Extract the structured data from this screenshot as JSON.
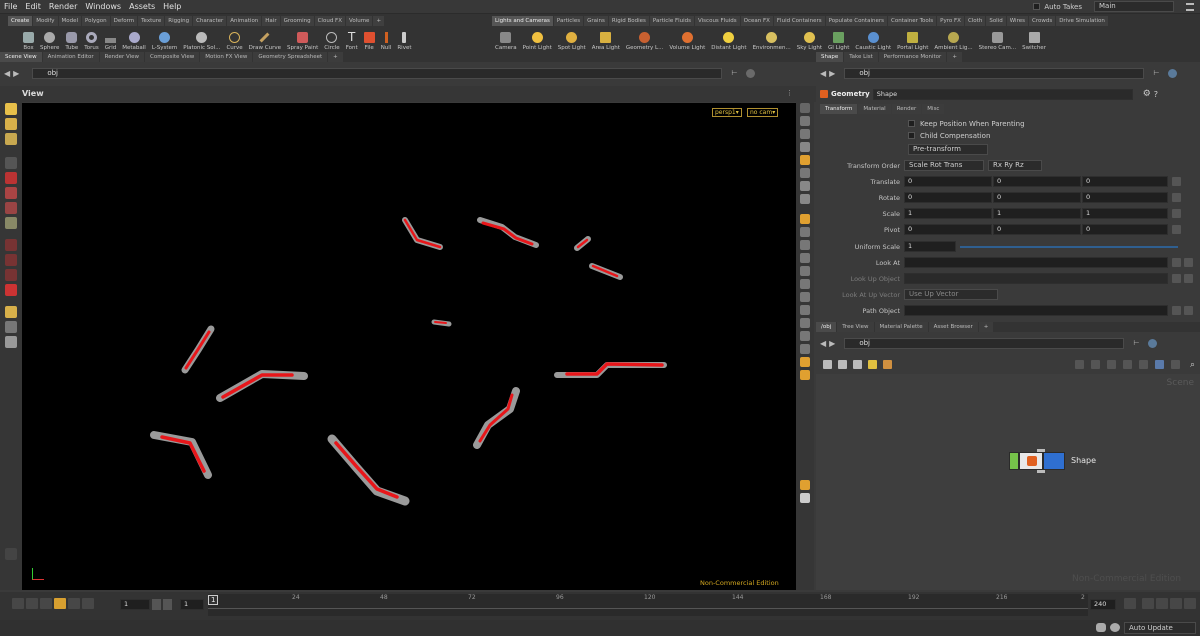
{
  "menu": {
    "items": [
      "File",
      "Edit",
      "Render",
      "Windows",
      "Assets",
      "Help"
    ],
    "auto_takes": "Auto Takes",
    "desktop": "Main"
  },
  "shelf_left_tabs": [
    "Create",
    "Modify",
    "Model",
    "Polygon",
    "Deform",
    "Texture",
    "Rigging",
    "Character",
    "Animation",
    "Hair",
    "Grooming",
    "Cloud FX",
    "Volume"
  ],
  "shelf_right_tabs": [
    "Lights and Cameras",
    "Particles",
    "Grains",
    "Rigid Bodies",
    "Particle Fluids",
    "Viscous Fluids",
    "Ocean FX",
    "Fluid Containers",
    "Populate Containers",
    "Container Tools",
    "Pyro FX",
    "Cloth",
    "Solid",
    "Wires",
    "Crowds",
    "Drive Simulation"
  ],
  "shelf_left_tools": [
    "Box",
    "Sphere",
    "Tube",
    "Torus",
    "Grid",
    "Metaball",
    "L-System",
    "Platonic Sol...",
    "Curve",
    "Draw Curve",
    "Spray Paint",
    "Circle",
    "Font",
    "File",
    "Null",
    "Rivet"
  ],
  "shelf_right_tools": [
    "Camera",
    "Point Light",
    "Spot Light",
    "Area Light",
    "Geometry L...",
    "Volume Light",
    "Distant Light",
    "Environmen...",
    "Sky Light",
    "GI Light",
    "Caustic Light",
    "Portal Light",
    "Ambient Lig...",
    "Stereo Cam...",
    "Switcher"
  ],
  "left_pane_tabs": [
    "Scene View",
    "Animation Editor",
    "Render View",
    "Composite View",
    "Motion FX View",
    "Geometry Spreadsheet"
  ],
  "left_path": "obj",
  "viewport": {
    "title": "View",
    "camera": "persp1▾",
    "cam_menu": "no cam▾",
    "watermark": "Non-Commercial Edition"
  },
  "param_pane_tabs": [
    "Shape",
    "Take List",
    "Performance Monitor"
  ],
  "param_path": "obj",
  "node": {
    "type": "Geometry",
    "name": "Shape"
  },
  "param_tabs": [
    "Transform",
    "Material",
    "Render",
    "Misc"
  ],
  "params": {
    "keep_position": "Keep Position When Parenting",
    "child_comp": "Child Compensation",
    "pre_transform": "Pre-transform",
    "transform_order_label": "Transform Order",
    "transform_order": "Scale Rot Trans",
    "rot_order": "Rx Ry Rz",
    "translate_label": "Translate",
    "translate": [
      "0",
      "0",
      "0"
    ],
    "rotate_label": "Rotate",
    "rotate": [
      "0",
      "0",
      "0"
    ],
    "scale_label": "Scale",
    "scale": [
      "1",
      "1",
      "1"
    ],
    "pivot_label": "Pivot",
    "pivot": [
      "0",
      "0",
      "0"
    ],
    "uniform_scale_label": "Uniform Scale",
    "uniform_scale": "1",
    "look_at_label": "Look At",
    "look_up_object_label": "Look Up Object",
    "look_at_up_vector_label": "Look At Up Vector",
    "look_at_up_vector": "Use Up Vector",
    "path_object_label": "Path Object"
  },
  "network_tabs": [
    "/obj",
    "Tree View",
    "Material Palette",
    "Asset Browser"
  ],
  "network_path": "obj",
  "network_context": "Scene",
  "network_watermark": "Non-Commercial Edition",
  "network_node_label": "Shape",
  "timeline": {
    "frame": "1",
    "start": "1",
    "end": "240",
    "current": "1",
    "ticks": [
      "24",
      "48",
      "72",
      "96",
      "120",
      "144",
      "168",
      "192",
      "216",
      "2"
    ]
  },
  "status": {
    "auto_update": "Auto Update"
  },
  "colors": {
    "accent_red": "#e8161a",
    "stroke_grey": "#9a9a9a",
    "node_green": "#76c24a",
    "node_blue": "#2f6fd0"
  }
}
